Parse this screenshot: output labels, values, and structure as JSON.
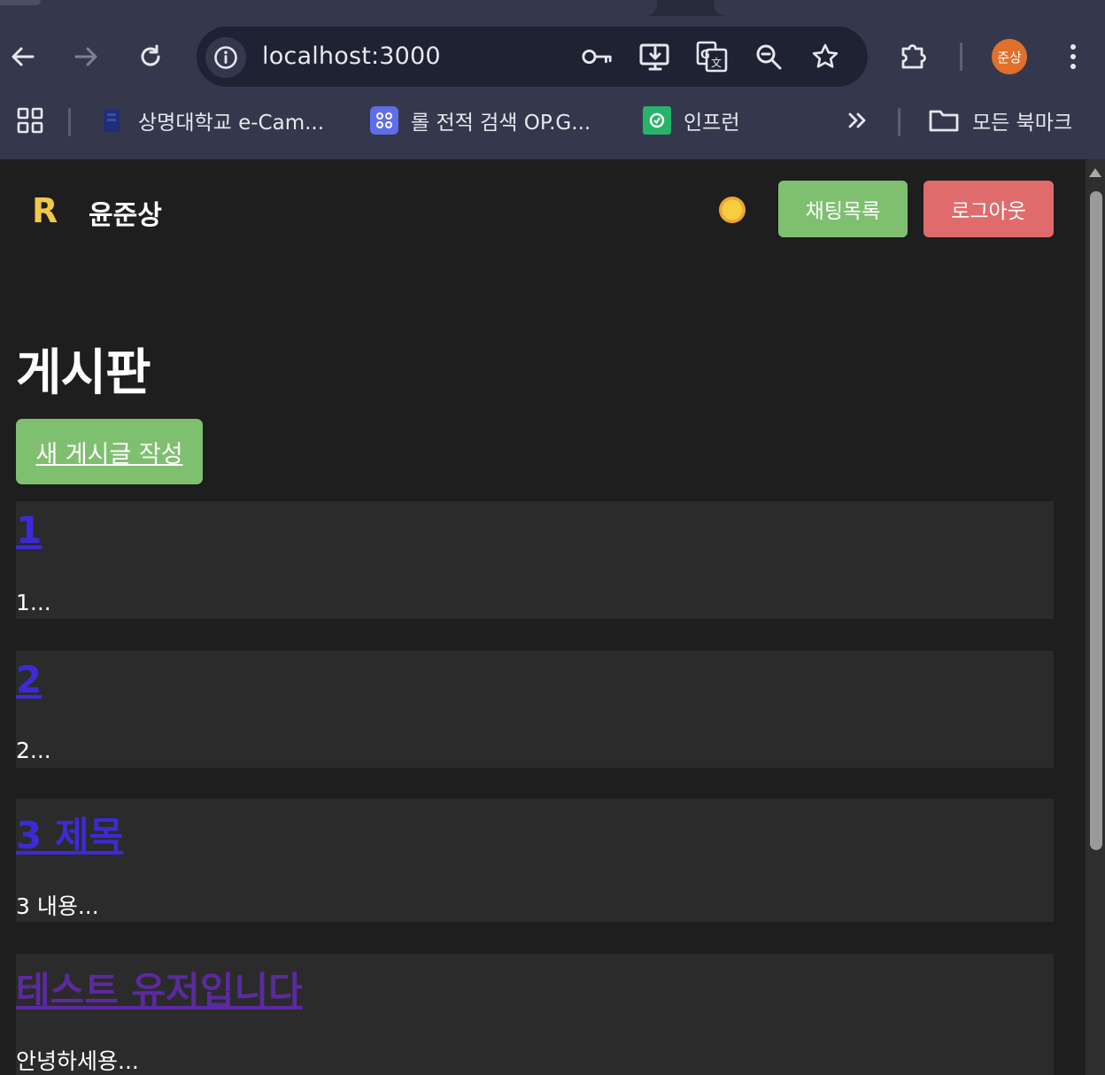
{
  "browser": {
    "url": "localhost:3000",
    "profile_initials": "준상",
    "bookmarks": [
      {
        "label": "상명대학교 e-Cam..."
      },
      {
        "label": "롤 전적 검색 OP.G..."
      },
      {
        "label": "인프런"
      }
    ],
    "all_bookmarks_label": "모든 북마크"
  },
  "header": {
    "logo": "R",
    "username": "윤준상",
    "chat_button": "채팅목록",
    "logout_button": "로그아웃"
  },
  "main": {
    "title": "게시판",
    "new_post_button": "새 게시글 작성",
    "posts": [
      {
        "title": "1",
        "excerpt": "1..."
      },
      {
        "title": "2",
        "excerpt": "2..."
      },
      {
        "title": "3 제목",
        "excerpt": "3 내용..."
      },
      {
        "title": "테스트 유저입니다",
        "excerpt": "안녕하세용..."
      }
    ]
  },
  "colors": {
    "accent_green": "#7fbf70",
    "logout_red": "#e06b6b",
    "logo_yellow": "#f2c84b",
    "link_unvisited": "#3d2ad6",
    "link_visited": "#5b2a9e"
  }
}
